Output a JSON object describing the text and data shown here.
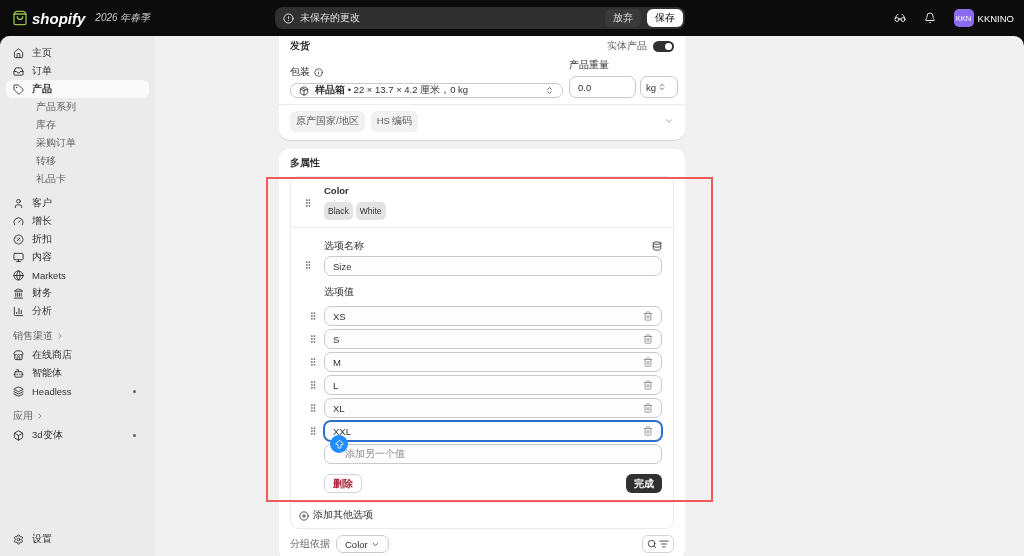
{
  "topbar": {
    "brand": "shopify",
    "edition": "2026 年春季",
    "message": "未保存的更改",
    "discard": "放弃",
    "save": "保存",
    "user_initials": "KKN",
    "user_name": "KKNINO"
  },
  "sidebar": {
    "groups": [
      {
        "items": [
          {
            "label": "主页",
            "selected": false
          },
          {
            "label": "订单",
            "selected": false
          },
          {
            "label": "产品",
            "selected": true,
            "children": [
              {
                "label": "产品系列",
                "selected": false
              },
              {
                "label": "库存",
                "selected": false
              },
              {
                "label": "采购订单",
                "selected": false
              },
              {
                "label": "转移",
                "selected": false
              },
              {
                "label": "礼品卡",
                "selected": false
              }
            ]
          }
        ]
      },
      {
        "items": [
          {
            "label": "客户",
            "selected": false
          },
          {
            "label": "增长",
            "selected": false
          },
          {
            "label": "折扣",
            "selected": false
          },
          {
            "label": "内容",
            "selected": false
          },
          {
            "label": "Markets",
            "selected": false
          },
          {
            "label": "财务",
            "selected": false
          },
          {
            "label": "分析",
            "selected": false
          }
        ]
      },
      {
        "heading": "销售渠道",
        "items": [
          {
            "label": "在线商店",
            "selected": false,
            "dot": false
          },
          {
            "label": "智能体",
            "selected": false,
            "dot": false
          },
          {
            "label": "Headless",
            "selected": false,
            "dot": true
          }
        ]
      },
      {
        "heading": "应用",
        "items": [
          {
            "label": "3d变体",
            "selected": false,
            "dot": true
          }
        ]
      }
    ],
    "settings": "设置"
  },
  "shipping": {
    "title": "发货",
    "physical_label": "实体产品",
    "physical_on": true,
    "package_label": "包装",
    "package_name": "样品箱",
    "package_detail": "• 22 × 13.7 × 4.2 厘米，0 kg",
    "weight_label": "产品重量",
    "weight": "0.0",
    "unit": "kg",
    "chips": [
      "原产国家/地区",
      "HS 编码"
    ]
  },
  "variants": {
    "title": "多属性",
    "options": [
      {
        "name": "Color",
        "values": [
          "Black",
          "White"
        ]
      }
    ],
    "editor": {
      "name_label": "选项名称",
      "name": "Size",
      "values_label": "选项值",
      "values": [
        {
          "value": "XS",
          "focused": false
        },
        {
          "value": "S",
          "focused": false
        },
        {
          "value": "M",
          "focused": false
        },
        {
          "value": "L",
          "focused": false
        },
        {
          "value": "XL",
          "focused": false
        },
        {
          "value": "XXL",
          "focused": true
        }
      ],
      "placeholder": "添加另一个值",
      "delete": "删除",
      "done": "完成"
    },
    "add_option": "添加其他选项",
    "group_label": "分组依据",
    "group_value": "Color"
  }
}
